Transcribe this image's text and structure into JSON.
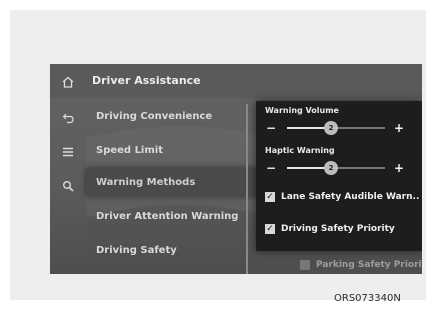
{
  "header": {
    "title": "Driver Assistance"
  },
  "side_icons": [
    {
      "icon": "home-icon",
      "glyph": "⌂"
    },
    {
      "icon": "back-icon",
      "glyph": "↩"
    },
    {
      "icon": "menu-icon",
      "glyph": "≡"
    },
    {
      "icon": "search-icon",
      "glyph": "🔍"
    }
  ],
  "menu": {
    "items": [
      {
        "label": "Driving Convenience"
      },
      {
        "label": "Speed Limit"
      },
      {
        "label": "Warning Methods"
      },
      {
        "label": "Driver Attention Warning"
      },
      {
        "label": "Driving Safety"
      }
    ],
    "selected_index": 2
  },
  "popup": {
    "warning_volume": {
      "label": "Warning Volume",
      "minus": "−",
      "plus": "+",
      "value": 2,
      "fraction": 0.45
    },
    "haptic_warning": {
      "label": "Haptic Warning",
      "minus": "−",
      "plus": "+",
      "value": 2,
      "fraction": 0.45
    },
    "options": [
      {
        "label": "Lane Safety Audible Warn..",
        "checked": true,
        "check": "✓"
      },
      {
        "label": "Driving Safety Priority",
        "checked": true,
        "check": "✓"
      }
    ]
  },
  "faded_option": {
    "label": "Parking Safety Priority"
  },
  "caption": "ORS073340N",
  "colors": {
    "screen_bg": "#5f5f5f",
    "popup_bg": "#1d1d1d",
    "text": "#ececec"
  }
}
